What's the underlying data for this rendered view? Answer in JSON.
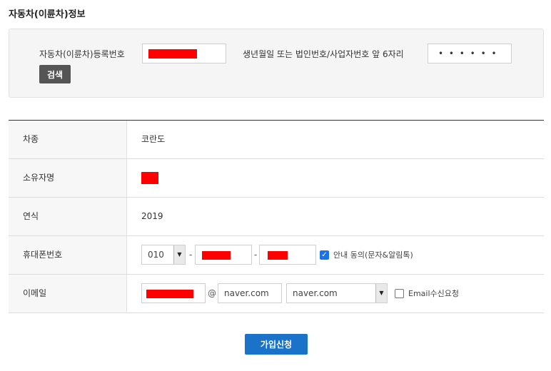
{
  "page": {
    "title": "자동차(이륜차)정보"
  },
  "search": {
    "reg_label": "자동차(이륜차)등록번호",
    "reg_value": "",
    "birth_label": "생년월일 또는 법인번호/사업자번호 앞 6자리",
    "birth_value": "• • • • • •",
    "button": "검색"
  },
  "table": {
    "car_type_label": "차종",
    "car_type_value": "코란도",
    "owner_label": "소유자명",
    "owner_value": "",
    "year_label": "연식",
    "year_value": "2019",
    "phone_label": "휴대폰번호",
    "phone_prefix": "010",
    "phone_sep1": "-",
    "phone_sep2": "-",
    "phone_consent": "안내 동의(문자&알림톡)",
    "email_label": "이메일",
    "email_at": "@",
    "email_domain": "naver.com",
    "email_domain_select": "naver.com",
    "email_consent": "Email수신요청"
  },
  "actions": {
    "join": "가입신청"
  },
  "colors": {
    "primary": "#1a73c8",
    "redaction": "#ff0000",
    "search_button": "#555555"
  }
}
